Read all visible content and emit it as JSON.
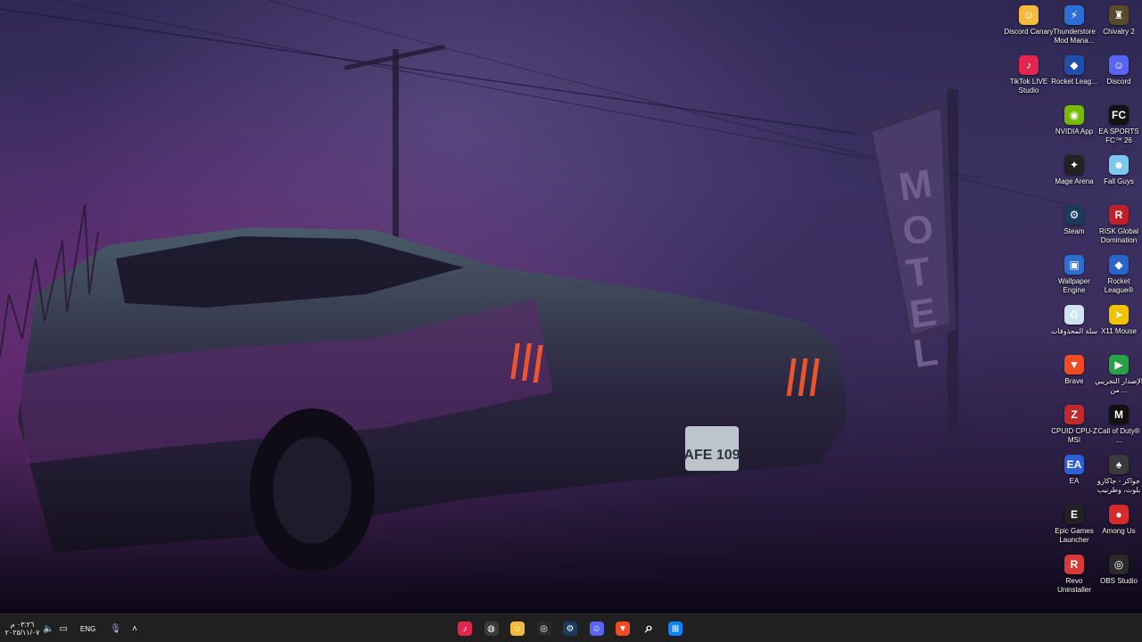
{
  "desktop_icons": [
    {
      "label": "Discord Canary",
      "icon": "discord-canary-icon",
      "color": "#f5b93d",
      "glyph": "☺"
    },
    {
      "label": "Thunderstore Mod Mana...",
      "icon": "thunderstore-icon",
      "color": "#2b6fd6",
      "glyph": "⚡"
    },
    {
      "label": "Chivalry 2",
      "icon": "chivalry-icon",
      "color": "#5a4a2c",
      "glyph": "♜"
    },
    {
      "label": "TikTok LIVE Studio",
      "icon": "tiktok-icon",
      "color": "#e2264d",
      "glyph": "♪"
    },
    {
      "label": "Rocket Leag...",
      "icon": "rocket-league-icon",
      "color": "#1f4fa8",
      "glyph": "◆"
    },
    {
      "label": "Discord",
      "icon": "discord-icon",
      "color": "#5865f2",
      "glyph": "☺"
    },
    {
      "label": "NVIDIA App",
      "icon": "nvidia-icon",
      "color": "#76b900",
      "glyph": "◉"
    },
    {
      "label": "EA SPORTS FC™ 26",
      "icon": "ea-fc-icon",
      "color": "#111111",
      "glyph": "FC"
    },
    {
      "label": "Mage Arena",
      "icon": "mage-arena-icon",
      "color": "#222222",
      "glyph": "✦"
    },
    {
      "label": "Fall Guys",
      "icon": "fall-guys-icon",
      "color": "#7ec8f0",
      "glyph": "☻"
    },
    {
      "label": "Steam",
      "icon": "steam-icon",
      "color": "#1b3a5c",
      "glyph": "⚙"
    },
    {
      "label": "RISK Global Domination",
      "icon": "risk-icon",
      "color": "#c0202a",
      "glyph": "R"
    },
    {
      "label": "Wallpaper Engine",
      "icon": "wallpaper-engine-icon",
      "color": "#2d6fd0",
      "glyph": "▣"
    },
    {
      "label": "Rocket League®",
      "icon": "rocket-league-2-icon",
      "color": "#2a64c8",
      "glyph": "◆"
    },
    {
      "label": "سلة المحذوفات",
      "icon": "recycle-bin-icon",
      "color": "#cfe3f2",
      "glyph": "♻"
    },
    {
      "label": "X11 Mouse",
      "icon": "x11-mouse-icon",
      "color": "#f2c200",
      "glyph": "➤"
    },
    {
      "label": "Brave",
      "icon": "brave-icon",
      "color": "#f14b23",
      "glyph": "▼"
    },
    {
      "label": "الإصدار التجريبي من ...",
      "icon": "beta-app-icon",
      "color": "#2aa147",
      "glyph": "▶"
    },
    {
      "label": "CPUID CPU-Z MSI",
      "icon": "cpuz-icon",
      "color": "#c02a2a",
      "glyph": "Z"
    },
    {
      "label": "Call of Duty® ...",
      "icon": "call-of-duty-icon",
      "color": "#111111",
      "glyph": "M"
    },
    {
      "label": "EA",
      "icon": "ea-icon",
      "color": "#2b5fd8",
      "glyph": "EA"
    },
    {
      "label": "جواكر - جاكارو بلوت، وطرنيب",
      "icon": "jawaker-icon",
      "color": "#3a3a3a",
      "glyph": "♠"
    },
    {
      "label": "Epic Games Launcher",
      "icon": "epic-games-icon",
      "color": "#222222",
      "glyph": "E"
    },
    {
      "label": "Among Us",
      "icon": "among-us-icon",
      "color": "#d62b2b",
      "glyph": "●"
    },
    {
      "label": "Revo Uninstaller",
      "icon": "revo-uninstaller-icon",
      "color": "#d83a3a",
      "glyph": "R"
    },
    {
      "label": "OBS Studio",
      "icon": "obs-studio-icon",
      "color": "#2a2a2a",
      "glyph": "◎"
    }
  ],
  "taskbar": {
    "apps": [
      {
        "name": "tiktok-live-taskbar",
        "icon": "tiktok-icon",
        "color": "#e2264d",
        "glyph": "♪"
      },
      {
        "name": "chrome-taskbar",
        "icon": "chrome-icon",
        "color": "#3a3a3a",
        "glyph": "◍"
      },
      {
        "name": "discord-canary-taskbar",
        "icon": "discord-canary-icon",
        "color": "#f5b93d",
        "glyph": "☺"
      },
      {
        "name": "obs-studio-taskbar",
        "icon": "obs-studio-icon",
        "color": "#2a2a2a",
        "glyph": "◎"
      },
      {
        "name": "steam-taskbar",
        "icon": "steam-icon",
        "color": "#1b3a5c",
        "glyph": "⚙"
      },
      {
        "name": "discord-taskbar",
        "icon": "discord-icon",
        "color": "#5865f2",
        "glyph": "☺"
      },
      {
        "name": "brave-taskbar",
        "icon": "brave-icon",
        "color": "#f14b23",
        "glyph": "▼"
      },
      {
        "name": "search-taskbar",
        "icon": "search-icon",
        "color": "transparent",
        "glyph": "⌕"
      },
      {
        "name": "start-button",
        "icon": "windows-start-icon",
        "color": "#0a84ff",
        "glyph": "⊞"
      }
    ],
    "tray": {
      "time": "٠٣:٢٦ م",
      "date": "٢٠٢٥/١١/٠٧",
      "language": "ENG"
    }
  },
  "wallpaper": {
    "sign_text": "MOTEL",
    "plate_text": "AFE 109"
  }
}
